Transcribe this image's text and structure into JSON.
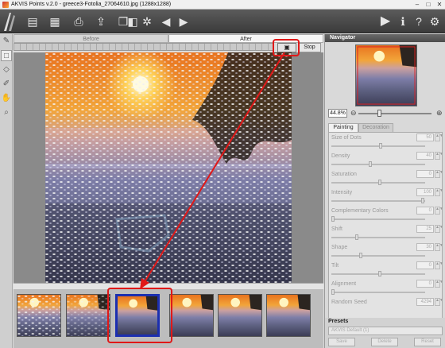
{
  "window": {
    "title": "AKVIS Points v.2.0 - greece3-Fotolia_27064610.jpg (1288x1288)",
    "controls": [
      "–",
      "□",
      "✕"
    ]
  },
  "toolbar": {
    "icons": [
      "open-icon",
      "save-icon",
      "print-icon",
      "share-icon",
      "batch-icon",
      "before-after-icon",
      "settings-icon",
      "undo-icon",
      "redo-icon",
      "run-icon",
      "info-icon",
      "help-icon",
      "preferences-icon"
    ]
  },
  "tabs": {
    "before": "Before",
    "after": "After"
  },
  "stop_label": "Stop",
  "navigator": {
    "title": "Navigator",
    "zoom": "44.8%"
  },
  "panel": {
    "tab_painting": "Painting",
    "tab_decoration": "Decoration",
    "params": [
      {
        "label": "Size of Dots",
        "value": "50"
      },
      {
        "label": "Density",
        "value": "40"
      },
      {
        "label": "Saturation",
        "value": "0"
      },
      {
        "label": "Intensity",
        "value": "100"
      },
      {
        "label": "Complementary Colors",
        "value": "0"
      },
      {
        "label": "Shift",
        "value": "25"
      },
      {
        "label": "Shape",
        "value": "30"
      },
      {
        "label": "Tilt",
        "value": "0"
      },
      {
        "label": "Alignment",
        "value": "0"
      },
      {
        "label": "Random Seed",
        "value": "4294"
      }
    ]
  },
  "presets": {
    "title": "Presets",
    "selected": "AKVIS Default (1)",
    "save": "Save",
    "delete": "Delete",
    "reset": "Reset"
  },
  "colors": {
    "highlight": "#e01818",
    "selected_thumb": "#1c2fb0"
  }
}
